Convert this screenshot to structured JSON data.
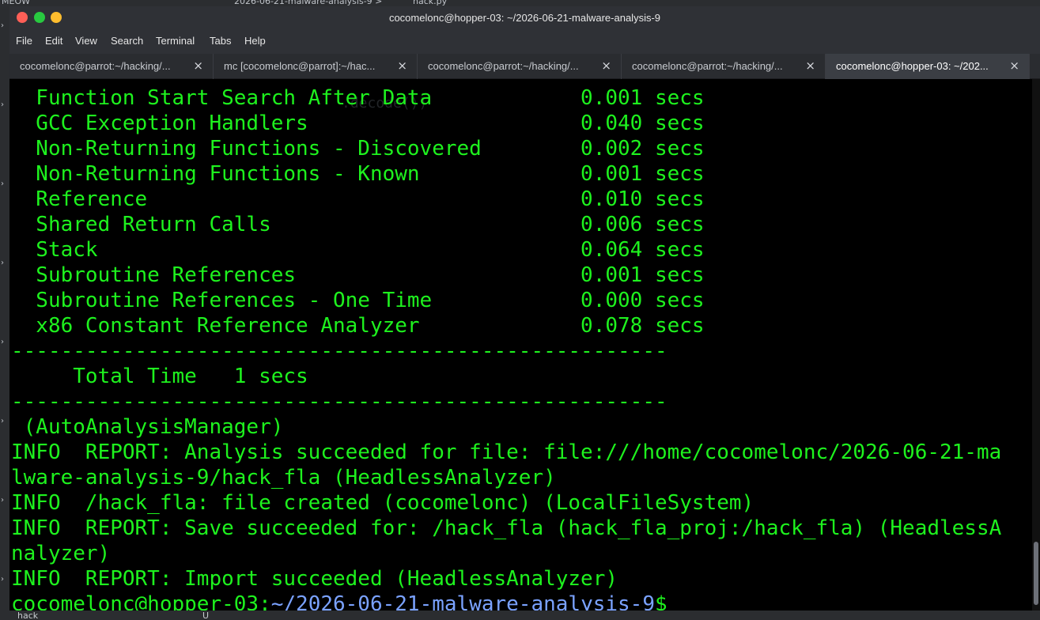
{
  "background": {
    "top_text": [
      "MEOW",
      "2026-06-21-malware-analysis-9 >",
      "hack.py"
    ],
    "bottom_text": [
      "hack",
      "U"
    ],
    "ghost_code": ".decode())"
  },
  "window": {
    "title": "cocomelonc@hopper-03: ~/2026-06-21-malware-analysis-9",
    "menu": [
      "File",
      "Edit",
      "View",
      "Search",
      "Terminal",
      "Tabs",
      "Help"
    ],
    "tabs": [
      {
        "label": "cocomelonc@parrot:~/hacking/..."
      },
      {
        "label": "mc [cocomelonc@parrot]:~/hac..."
      },
      {
        "label": "cocomelonc@parrot:~/hacking/..."
      },
      {
        "label": "cocomelonc@parrot:~/hacking/..."
      },
      {
        "label": "cocomelonc@hopper-03: ~/202..."
      }
    ],
    "close_glyph": "×"
  },
  "terminal": {
    "lines": [
      "  Function Start Search After Data            0.001 secs",
      "  GCC Exception Handlers                      0.040 secs",
      "  Non-Returning Functions - Discovered        0.002 secs",
      "  Non-Returning Functions - Known             0.001 secs",
      "  Reference                                   0.010 secs",
      "  Shared Return Calls                         0.006 secs",
      "  Stack                                       0.064 secs",
      "  Subroutine References                       0.001 secs",
      "  Subroutine References - One Time            0.000 secs",
      "  x86 Constant Reference Analyzer             0.078 secs",
      "-----------------------------------------------------",
      "     Total Time   1 secs",
      "-----------------------------------------------------",
      " (AutoAnalysisManager)",
      "INFO  REPORT: Analysis succeeded for file: file:///home/cocomelonc/2026-06-21-ma",
      "lware-analysis-9/hack_fla (HeadlessAnalyzer)",
      "INFO  /hack_fla: file created (cocomelonc) (LocalFileSystem)",
      "INFO  REPORT: Save succeeded for: /hack_fla (hack_fla_proj:/hack_fla) (HeadlessA",
      "nalyzer)",
      "INFO  REPORT: Import succeeded (HeadlessAnalyzer)"
    ],
    "prompt": {
      "user_host": "cocomelonc@hopper-03",
      "colon": ":",
      "path": "~/2026-06-21-malware-analysis-9",
      "dollar": "$"
    }
  }
}
